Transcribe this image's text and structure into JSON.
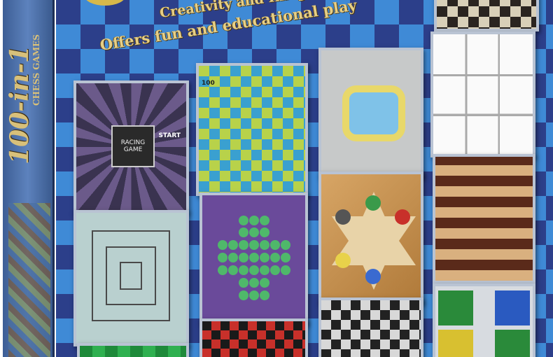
{
  "spine": {
    "title": "100-in-1",
    "subtitle": "CHESS GAMES"
  },
  "front": {
    "tagline_1": "Creativity and Imagination",
    "tagline_2": "Offers fun and educational play"
  },
  "boards": {
    "racing": {
      "center_label": "RACING GAME",
      "start_label": "START"
    },
    "snakes": {
      "number": "100"
    }
  },
  "colors": {
    "box_blue_dark": "#2c3f8a",
    "box_blue_light": "#3f8ad6",
    "text_gold": "#e6cf86"
  }
}
